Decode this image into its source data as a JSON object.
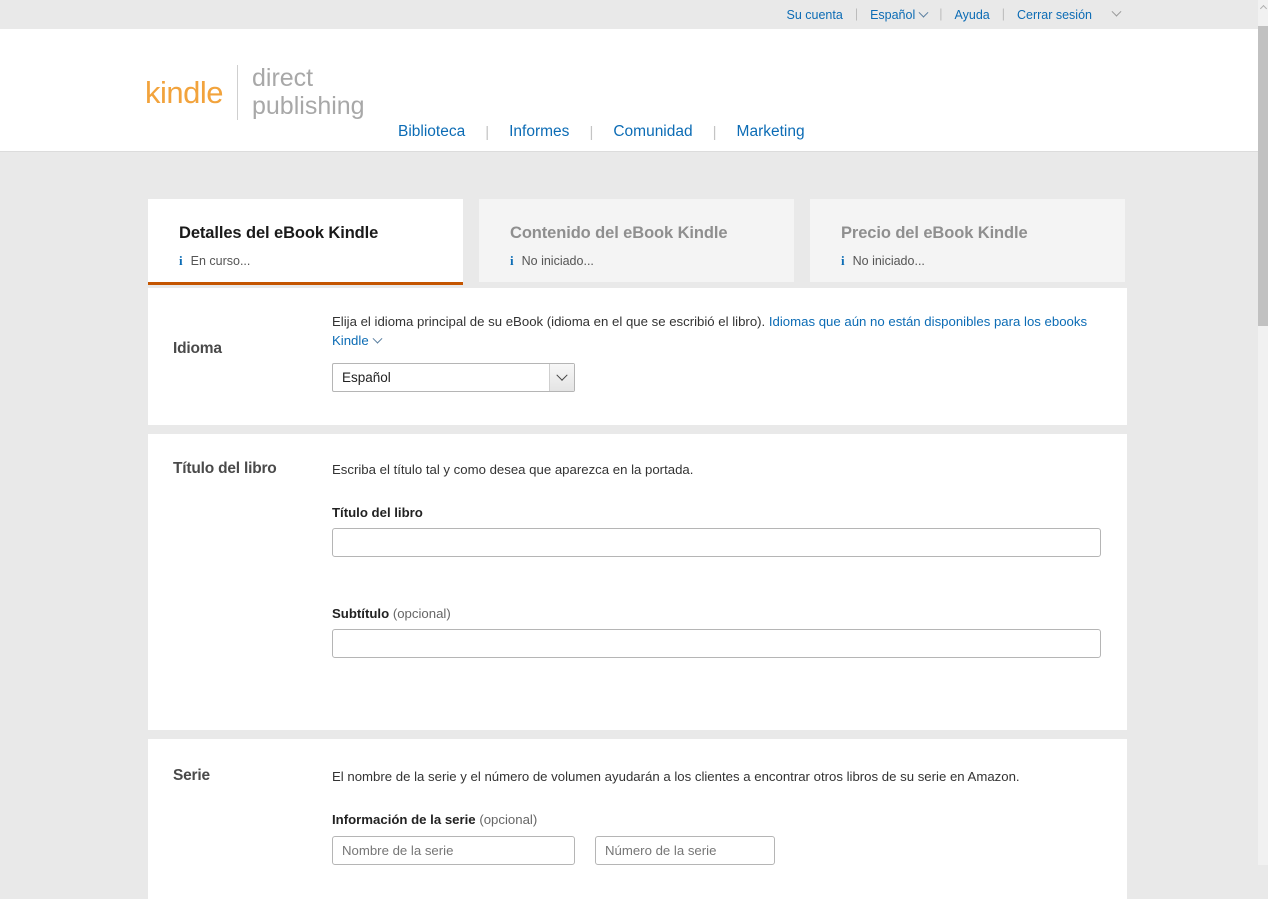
{
  "topbar": {
    "links": [
      {
        "label": "Su cuenta",
        "caret": false
      },
      {
        "label": "Español",
        "caret": true
      },
      {
        "label": "Ayuda",
        "caret": false
      },
      {
        "label": "Cerrar sesión",
        "caret": false
      }
    ],
    "separator": "|",
    "trailing_caret_icon": "chevron-down-icon"
  },
  "header": {
    "logo": {
      "brand": "kindle",
      "line1": "direct",
      "line2": "publishing",
      "brand_color": "#f2a33c",
      "text_color": "#a8a8a8"
    },
    "nav": [
      {
        "label": "Biblioteca"
      },
      {
        "label": "Informes"
      },
      {
        "label": "Comunidad"
      },
      {
        "label": "Marketing"
      }
    ],
    "nav_separator": "|",
    "link_color": "#0c6cb5"
  },
  "tabs": [
    {
      "title": "Detalles del eBook Kindle",
      "status": "En curso...",
      "active": true
    },
    {
      "title": "Contenido del eBook Kindle",
      "status": "No iniciado...",
      "active": false
    },
    {
      "title": "Precio del eBook Kindle",
      "status": "No iniciado...",
      "active": false
    }
  ],
  "tab_accent_color": "#c45500",
  "sections": {
    "idioma": {
      "label": "Idioma",
      "desc_text": "Elija el idioma principal de su eBook (idioma en el que se escribió el libro). ",
      "desc_link": "Idiomas que aún no están disponibles para los ebooks Kindle",
      "select_value": "Español",
      "select_caret_icon": "chevron-down-icon"
    },
    "titulo": {
      "label": "Título del libro",
      "desc": "Escriba el título tal y como desea que aparezca en la portada.",
      "title_field_label": "Título del libro",
      "title_field_value": "",
      "title_field_placeholder": "",
      "subtitle_field_label": "Subtítulo",
      "subtitle_field_optional": "(opcional)",
      "subtitle_field_value": "",
      "subtitle_field_placeholder": ""
    },
    "serie": {
      "label": "Serie",
      "desc": "El nombre de la serie y el número de volumen ayudarán a los clientes a encontrar otros libros de su serie en Amazon.",
      "info_field_label": "Información de la serie",
      "info_field_optional": "(opcional)",
      "name_placeholder": "Nombre de la serie",
      "name_value": "",
      "number_placeholder": "Número de la serie",
      "number_value": ""
    }
  },
  "scrollbar": {
    "up_arrow_icon": "chevron-up-icon"
  }
}
